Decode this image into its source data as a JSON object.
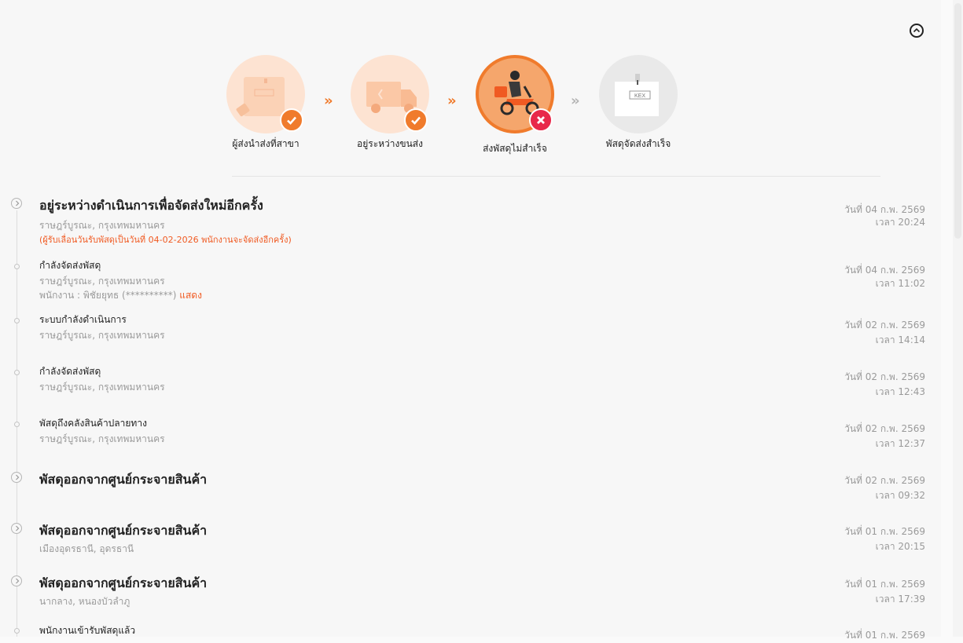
{
  "colors": {
    "accent": "#f05a22",
    "success_badge": "#f07b2c",
    "fail_badge": "#e8284a",
    "arrow_done": "#f07b2c",
    "arrow_pending": "#b5b5b5"
  },
  "progress": {
    "steps": [
      {
        "label": "ผู้ส่งนำส่งที่สาขา",
        "status": "done",
        "icon": "parcel-dropoff-icon"
      },
      {
        "label": "อยู่ระหว่างขนส่ง",
        "status": "done",
        "icon": "delivery-truck-icon"
      },
      {
        "label": "ส่งพัสดุไม่สำเร็จ",
        "status": "failed",
        "icon": "courier-scooter-icon"
      },
      {
        "label": "พัสดุจัดส่งสำเร็จ",
        "status": "pending",
        "icon": "delivered-box-icon"
      }
    ],
    "arrow_glyph": "»"
  },
  "timeline": [
    {
      "title": "อยู่ระหว่างดำเนินการเพื่อจัดส่งใหม่อีกครั้ง",
      "location": "ราษฎร์บูรณะ, กรุงเทพมหานคร",
      "note": "(ผู้รับเลื่อนวันรับพัสดุเป็นวันที่ 04-02-2026 พนักงานจะจัดส่งอีกครั้ง)",
      "date": "วันที่ 04 ก.พ. 2569",
      "time": "เวลา 20:24"
    },
    {
      "title": "กำลังจัดส่งพัสดุ",
      "location": "ราษฎร์บูรณะ, กรุงเทพมหานคร",
      "staff": "พนักงาน : พิชัยยุทธ (**********)",
      "staff_link": "แสดง",
      "date": "วันที่ 04 ก.พ. 2569",
      "time": "เวลา 11:02"
    },
    {
      "title": "ระบบกำลังดำเนินการ",
      "location": "ราษฎร์บูรณะ, กรุงเทพมหานคร",
      "date": "วันที่ 02 ก.พ. 2569",
      "time": "เวลา 14:14"
    },
    {
      "title": "กำลังจัดส่งพัสดุ",
      "location": "ราษฎร์บูรณะ, กรุงเทพมหานคร",
      "date": "วันที่ 02 ก.พ. 2569",
      "time": "เวลา 12:43"
    },
    {
      "title": "พัสดุถึงคลังสินค้าปลายทาง",
      "location": "ราษฎร์บูรณะ, กรุงเทพมหานคร",
      "date": "วันที่ 02 ก.พ. 2569",
      "time": "เวลา 12:37"
    },
    {
      "title": "พัสดุออกจากศูนย์กระจายสินค้า",
      "location": "",
      "date": "วันที่ 02 ก.พ. 2569",
      "time": "เวลา 09:32"
    },
    {
      "title": "พัสดุออกจากศูนย์กระจายสินค้า",
      "location": "เมืองอุดรธานี, อุดรธานี",
      "date": "วันที่ 01 ก.พ. 2569",
      "time": "เวลา 20:15"
    },
    {
      "title": "พัสดุออกจากศูนย์กระจายสินค้า",
      "location": "นากลาง, หนองบัวลำภู",
      "date": "วันที่ 01 ก.พ. 2569",
      "time": "เวลา 17:39"
    },
    {
      "title": "พนักงานเข้ารับพัสดุแล้ว",
      "location": "",
      "date": "วันที่ 01 ก.พ. 2569",
      "time": ""
    }
  ]
}
